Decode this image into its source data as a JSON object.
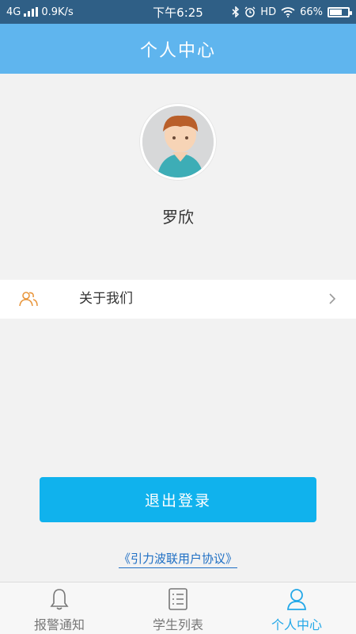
{
  "status_bar": {
    "network": "4G",
    "speed": "0.9K/s",
    "time": "下午6:25",
    "hd": "HD",
    "battery_percent": "66%",
    "battery_level": 0.66
  },
  "header": {
    "title": "个人中心"
  },
  "profile": {
    "name": "罗欣"
  },
  "menu": {
    "about_label": "关于我们"
  },
  "logout": {
    "label": "退出登录"
  },
  "agreement": {
    "label": "《引力波联用户协议》"
  },
  "tabs": [
    {
      "label": "报警通知",
      "icon": "bell-icon",
      "active": false
    },
    {
      "label": "学生列表",
      "icon": "list-icon",
      "active": false
    },
    {
      "label": "个人中心",
      "icon": "person-icon",
      "active": true
    }
  ],
  "colors": {
    "header": "#5fb5ee",
    "status_bar": "#2f5f86",
    "button": "#10b2ed",
    "tab_active": "#24a8e8",
    "link": "#1e6fc4",
    "menu_icon": "#e8963c"
  }
}
